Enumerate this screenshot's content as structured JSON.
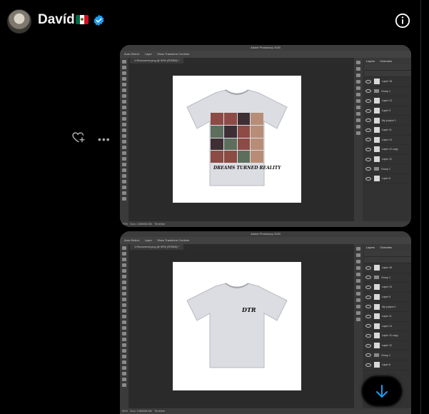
{
  "header": {
    "username": "Davíd",
    "flag": "mexico-flag",
    "verified_icon": "verified-badge-icon",
    "info_icon": "info-icon"
  },
  "actions": {
    "like_icon": "heart-plus-icon",
    "more_label": "•••"
  },
  "photoshop": {
    "app_title": "Adobe Photoshop 2020",
    "doc_tab": "1-Recovered.png @ 50% (RGB/8) *",
    "options": [
      "Auto-Select:",
      "Layer",
      "Show Transform Controls"
    ],
    "layers_tabs": [
      "Layers",
      "Channels"
    ],
    "status_zoom": "50%",
    "status_doc": "Doc: 2.86M/6.5M",
    "timeline_label": "Timeline"
  },
  "screenshot1": {
    "layers": [
      "Layer 18",
      "Group 1",
      "Layer 13",
      "Layer 9",
      "My project 1",
      "Layer 11",
      "Layer 14",
      "Layer 12 copy",
      "Layer 12",
      "Group 1",
      "Layer 6"
    ],
    "print_text": "DREAMS TURNED REALITY"
  },
  "screenshot2": {
    "layers": [
      "Layer 18",
      "Group 1",
      "Layer 13",
      "Layer 9",
      "My project 1",
      "Layer 11",
      "Layer 14",
      "Layer 12 copy",
      "Layer 12",
      "Group 1",
      "Layer 6"
    ],
    "print_text": "DTR"
  },
  "scroll_button": {
    "icon": "arrow-down-icon"
  },
  "colors": {
    "background": "#000000",
    "verified_blue": "#1d9bf0",
    "photoshop_bg": "#2b2b2b"
  }
}
